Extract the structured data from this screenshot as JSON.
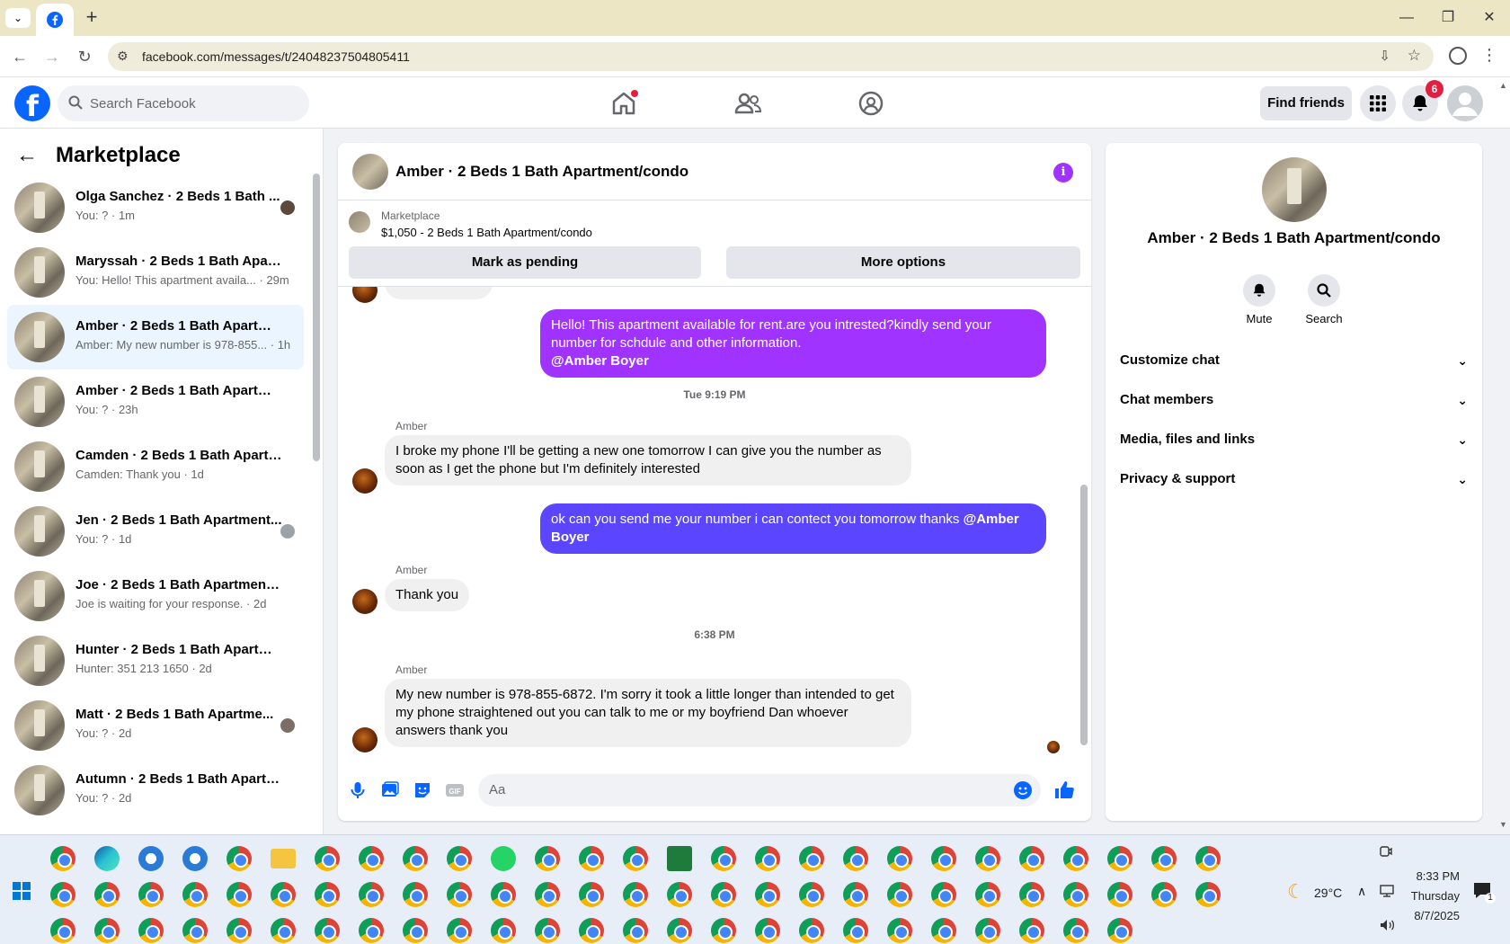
{
  "browser": {
    "url": "facebook.com/messages/t/24048237504805411",
    "window_controls": [
      "minimize",
      "restore",
      "close"
    ]
  },
  "fb_header": {
    "search_placeholder": "Search Facebook",
    "find_friends_label": "Find friends",
    "notification_count": "6"
  },
  "sidebar": {
    "title": "Marketplace",
    "conversations": [
      {
        "name": "Olga Sanchez · 2 Beds 1 Bath ...",
        "preview": "You: ? · 1m",
        "active": false
      },
      {
        "name": "Maryssah · 2 Beds 1 Bath Apart...",
        "preview": "You: Hello! This apartment availa... · 29m",
        "active": false
      },
      {
        "name": "Amber · 2 Beds 1 Bath Apartmen...",
        "preview": "Amber: My new number is 978-855... · 1h",
        "active": true
      },
      {
        "name": "Amber · 2 Beds 1 Bath Apartmen...",
        "preview": "You: ? · 23h",
        "active": false
      },
      {
        "name": "Camden · 2 Beds 1 Bath Apartm...",
        "preview": "Camden: Thank you · 1d",
        "active": false
      },
      {
        "name": "Jen · 2 Beds 1 Bath Apartment...",
        "preview": "You: ? · 1d",
        "active": false
      },
      {
        "name": "Joe · 2 Beds 1 Bath Apartment/c...",
        "preview": "Joe is waiting for your response. · 2d",
        "active": false
      },
      {
        "name": "Hunter · 2 Beds 1 Bath Apartme...",
        "preview": "Hunter: 351 213 1650 · 2d",
        "active": false
      },
      {
        "name": "Matt · 2 Beds 1 Bath Apartme...",
        "preview": "You: ? · 2d",
        "active": false
      },
      {
        "name": "Autumn · 2 Beds 1 Bath Apartme...",
        "preview": "You: ? · 2d",
        "active": false
      }
    ]
  },
  "chat": {
    "title": "Amber · 2 Beds 1 Bath Apartment/condo",
    "marketplace_label": "Marketplace",
    "listing": "$1,050 - 2 Beds 1 Bath Apartment/condo",
    "mark_pending_label": "Mark as pending",
    "more_options_label": "More options",
    "messages": {
      "out1_text": "Hello! This apartment available for rent.are you intrested?kindly send your number for schdule and other information.",
      "out1_mention": "@Amber Boyer",
      "ts1": "Tue 9:19 PM",
      "in1_sender": "Amber",
      "in1_text": "I broke my phone I'll be getting a new one tomorrow I can give you the number as soon as I get the phone but I'm definitely interested",
      "out2_text": "ok  can you send me your number i can contect you tomorrow thanks ",
      "out2_mention": "@Amber Boyer",
      "in2_sender": "Amber",
      "in2_text": "Thank you",
      "ts2": "6:38 PM",
      "in3_sender": "Amber",
      "in3_text": "My new number is 978-855-6872. I'm sorry it took a little longer than intended to get my phone straightened out you can talk to me or my boyfriend Dan whoever answers thank you"
    },
    "composer_placeholder": "Aa",
    "colors": {
      "out1": "#a033ff",
      "out2": "#5b45ff"
    }
  },
  "right_panel": {
    "name": "Amber · 2 Beds 1 Bath Apartment/condo",
    "mute_label": "Mute",
    "search_label": "Search",
    "sections": [
      "Customize chat",
      "Chat members",
      "Media, files and links",
      "Privacy & support"
    ]
  },
  "taskbar": {
    "temperature": "29°C",
    "time": "8:33 PM",
    "day": "Thursday",
    "date": "8/7/2025",
    "notification_count": "1"
  }
}
